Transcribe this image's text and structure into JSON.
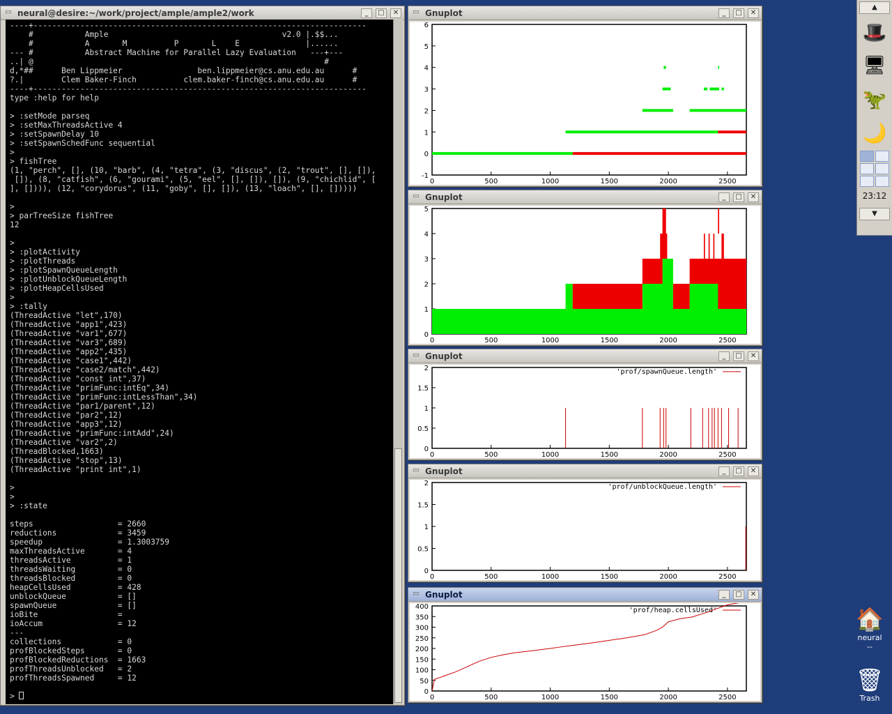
{
  "terminal": {
    "title": "neural@desire:~/work/project/ample/ample2/work",
    "lines": [
      "----+-----------------------------------------------------------------------",
      "    #           Ample                                     v2.0 |.$$...",
      "    #           A       M          P       L    E              |......",
      "--- #           Abstract Machine for Parallel Lazy Evaluation   ---+---",
      "..| @                                                              #",
      "d,*##      Ben Lippmeier                ben.lippmeier@cs.anu.edu.au      #",
      "?.|        Clem Baker-Finch          clem.baker-finch@cs.anu.edu.au      #",
      "----+-----------------------------------------------------------------------",
      "type :help for help",
      "",
      "> :setMode parseq",
      "> :setMaxThreadsActive 4",
      "> :setSpawnDelay 10",
      "> :setSpawnSchedFunc sequential",
      ">",
      "> fishTree",
      "(1, \"perch\", [], (10, \"barb\", (4, \"tetra\", (3, \"discus\", (2, \"trout\", [], []),",
      " []), (8, \"catfish\", (6, \"gourami\", (5, \"eel\", [], []), []), (9, \"chichlid\", [",
      "], []))), (12, \"corydorus\", (11, \"goby\", [], []), (13, \"loach\", [], []))))",
      "",
      ">",
      "> parTreeSize fishTree",
      "12",
      "",
      ">",
      "> :plotActivity",
      "> :plotThreads",
      "> :plotSpawnQueueLength",
      "> :plotUnblockQueueLength",
      "> :plotHeapCellsUsed",
      ">",
      "> :tally",
      "(ThreadActive \"let\",170)",
      "(ThreadActive \"app1\",423)",
      "(ThreadActive \"var1\",677)",
      "(ThreadActive \"var3\",689)",
      "(ThreadActive \"app2\",435)",
      "(ThreadActive \"case1\",442)",
      "(ThreadActive \"case2/match\",442)",
      "(ThreadActive \"const int\",37)",
      "(ThreadActive \"primFunc:intEq\",34)",
      "(ThreadActive \"primFunc:intLessThan\",34)",
      "(ThreadActive \"par1/parent\",12)",
      "(ThreadActive \"par2\",12)",
      "(ThreadActive \"app3\",12)",
      "(ThreadActive \"primFunc:intAdd\",24)",
      "(ThreadActive \"var2\",2)",
      "(ThreadBlocked,1663)",
      "(ThreadActive \"stop\",13)",
      "(ThreadActive \"print int\",1)",
      "",
      ">",
      ">",
      "> :state",
      "",
      "steps                  = 2660",
      "reductions             = 3459",
      "speedup                = 1.3003759",
      "maxThreadsActive       = 4",
      "threadsActive          = 1",
      "threadsWaiting         = 0",
      "threadsBlocked         = 0",
      "heapCellsUsed          = 428",
      "unblockQueue           = []",
      "spawnQueue             = []",
      "ioBite                 =",
      "ioAccum                = 12",
      "---",
      "collections            = 0",
      "profBlockedSteps       = 0",
      "profBlockedReductions  = 1663",
      "profThreadsUnblocked   = 2",
      "profThreadsSpawned     = 12",
      ""
    ],
    "prompt": "> "
  },
  "plots": [
    {
      "title": "Gnuplot",
      "legend": ""
    },
    {
      "title": "Gnuplot",
      "legend": ""
    },
    {
      "title": "Gnuplot",
      "legend": "'prof/spawnQueue.length'"
    },
    {
      "title": "Gnuplot",
      "legend": "'prof/unblockQueue.length'"
    },
    {
      "title": "Gnuplot",
      "legend": "'prof/heap.cellsUsed'"
    }
  ],
  "chart_data": [
    {
      "type": "line",
      "xlim": [
        0,
        2660
      ],
      "ylim": [
        -1,
        6
      ],
      "xticks": [
        0,
        500,
        1000,
        1500,
        2000,
        2500
      ],
      "yticks": [
        -1,
        0,
        1,
        2,
        3,
        4,
        5,
        6
      ],
      "series": [
        {
          "color": "#00ee00",
          "segments": [
            [
              0,
              1190,
              0
            ],
            [
              1130,
              2420,
              1
            ],
            [
              1780,
              2040,
              2
            ],
            [
              2180,
              2660,
              2
            ],
            [
              1950,
              2020,
              3
            ],
            [
              2300,
              2330,
              3
            ],
            [
              2350,
              2430,
              3
            ],
            [
              2450,
              2470,
              3
            ],
            [
              1960,
              1980,
              4
            ],
            [
              2420,
              2430,
              4
            ]
          ]
        },
        {
          "color": "#ee0000",
          "segments": [
            [
              1190,
              2660,
              0
            ],
            [
              2420,
              2660,
              1
            ]
          ]
        }
      ]
    },
    {
      "type": "area",
      "xlim": [
        0,
        2660
      ],
      "ylim": [
        0,
        5
      ],
      "xticks": [
        0,
        500,
        1000,
        1500,
        2000,
        2500
      ],
      "yticks": [
        0,
        1,
        2,
        3,
        4,
        5
      ],
      "series": [
        {
          "color": "#00ee00",
          "blocks": [
            [
              0,
              2660,
              0,
              1
            ],
            [
              1130,
              1190,
              1,
              2
            ],
            [
              1780,
              2040,
              1,
              2
            ],
            [
              2180,
              2660,
              1,
              2
            ],
            [
              1950,
              2040,
              2,
              3
            ],
            [
              2300,
              2310,
              2,
              3
            ],
            [
              2340,
              2380,
              2,
              3
            ],
            [
              1960,
              1980,
              3,
              4
            ]
          ]
        },
        {
          "color": "#ee0000",
          "blocks": [
            [
              1190,
              1780,
              1,
              2
            ],
            [
              1780,
              1950,
              2,
              3
            ],
            [
              1930,
              1990,
              3,
              4
            ],
            [
              1950,
              1980,
              4,
              5
            ],
            [
              2040,
              2180,
              1,
              2
            ],
            [
              2180,
              2660,
              2,
              3
            ],
            [
              2300,
              2310,
              3,
              4
            ],
            [
              2340,
              2350,
              3,
              4
            ],
            [
              2380,
              2390,
              3,
              4
            ],
            [
              2420,
              2430,
              4,
              5
            ],
            [
              2450,
              2470,
              3,
              4
            ],
            [
              2420,
              2660,
              1,
              2
            ]
          ]
        }
      ]
    },
    {
      "type": "line",
      "xlim": [
        0,
        2660
      ],
      "ylim": [
        0,
        2
      ],
      "xticks": [
        0,
        500,
        1000,
        1500,
        2000,
        2500
      ],
      "yticks": [
        0,
        0.5,
        1,
        1.5,
        2
      ],
      "series": [
        {
          "name": "'prof/spawnQueue.length'",
          "color": "#cc0000",
          "spikes": [
            1130,
            1780,
            1930,
            1960,
            1980,
            2190,
            2290,
            2340,
            2370,
            2390,
            2420,
            2450,
            2510,
            2590
          ],
          "value": 1
        }
      ]
    },
    {
      "type": "line",
      "xlim": [
        0,
        2660
      ],
      "ylim": [
        0,
        2
      ],
      "xticks": [
        0,
        500,
        1000,
        1500,
        2000,
        2500
      ],
      "yticks": [
        0,
        0.5,
        1,
        1.5,
        2
      ],
      "series": [
        {
          "name": "'prof/unblockQueue.length'",
          "color": "#cc0000",
          "spikes": [
            2655
          ],
          "value": 1
        }
      ]
    },
    {
      "type": "line",
      "xlim": [
        0,
        2660
      ],
      "ylim": [
        0,
        400
      ],
      "xticks": [
        0,
        500,
        1000,
        1500,
        2000,
        2500
      ],
      "yticks": [
        0,
        50,
        100,
        150,
        200,
        250,
        300,
        350,
        400
      ],
      "series": [
        {
          "name": "'prof/heap.cellsUsed'",
          "color": "#cc0000",
          "x": [
            0,
            20,
            100,
            200,
            300,
            400,
            500,
            600,
            700,
            800,
            900,
            1000,
            1100,
            1200,
            1300,
            1400,
            1500,
            1600,
            1700,
            1800,
            1900,
            1950,
            2000,
            2100,
            2200,
            2300,
            2400,
            2500,
            2600,
            2660
          ],
          "y": [
            0,
            55,
            70,
            90,
            115,
            140,
            158,
            170,
            180,
            186,
            193,
            200,
            208,
            215,
            222,
            230,
            238,
            246,
            255,
            265,
            285,
            300,
            325,
            340,
            348,
            365,
            385,
            405,
            415,
            428
          ]
        }
      ]
    }
  ],
  "dock": {
    "clock": "23:12",
    "up_arrow": "▲",
    "down_arrow": "▼"
  },
  "desktop": {
    "home_label": "neural",
    "home_sub": "--",
    "trash_label": "Trash"
  }
}
